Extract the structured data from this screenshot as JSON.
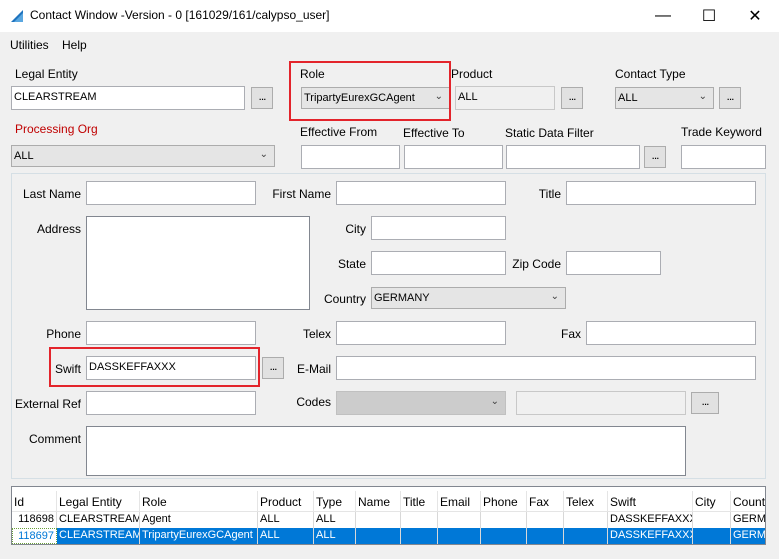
{
  "window": {
    "title": "Contact Window -Version - 0 [161029/161/calypso_user]",
    "minimize": "—",
    "maximize": "☐",
    "close": "✕"
  },
  "menu": {
    "items": [
      "Utilities",
      "Help"
    ]
  },
  "top": {
    "legal_entity_label": "Legal Entity",
    "legal_entity_value": "CLEARSTREAM",
    "role_label": "Role",
    "role_value": "TripartyEurexGCAgent",
    "product_label": "Product",
    "product_value": "ALL",
    "contact_type_label": "Contact Type",
    "contact_type_value": "ALL",
    "processing_org_label": "Processing Org",
    "processing_org_value": "ALL",
    "effective_from_label": "Effective From",
    "effective_to_label": "Effective To",
    "static_data_filter_label": "Static Data Filter",
    "trade_keyword_label": "Trade Keyword",
    "dots": "..."
  },
  "form": {
    "last_name_label": "Last Name",
    "first_name_label": "First Name",
    "title_label": "Title",
    "address_label": "Address",
    "city_label": "City",
    "state_label": "State",
    "zip_label": "Zip Code",
    "country_label": "Country",
    "country_value": "GERMANY",
    "phone_label": "Phone",
    "telex_label": "Telex",
    "fax_label": "Fax",
    "swift_label": "Swift",
    "swift_value": "DASSKEFFAXXX",
    "email_label": "E-Mail",
    "external_ref_label": "External Ref",
    "codes_label": "Codes",
    "comment_label": "Comment"
  },
  "table": {
    "columns": [
      "Id",
      "Legal Entity",
      "Role",
      "Product",
      "Type",
      "Name",
      "Title",
      "Email",
      "Phone",
      "Fax",
      "Telex",
      "Swift",
      "City",
      "Count"
    ],
    "rows": [
      [
        "118698",
        "CLEARSTREAM",
        "Agent",
        "ALL",
        "ALL",
        "",
        "",
        "",
        "",
        "",
        "",
        "DASSKEFFAXXX",
        "",
        "GERMA"
      ],
      [
        "118697",
        "CLEARSTREAM",
        "TripartyEurexGCAgent",
        "ALL",
        "ALL",
        "",
        "",
        "",
        "",
        "",
        "",
        "DASSKEFFAXXX",
        "",
        "GERMA"
      ]
    ],
    "selected_row": 1
  },
  "colors": {
    "highlight": "#e3242b",
    "selection": "#0078d7",
    "processing_org_label": "#c00000"
  }
}
